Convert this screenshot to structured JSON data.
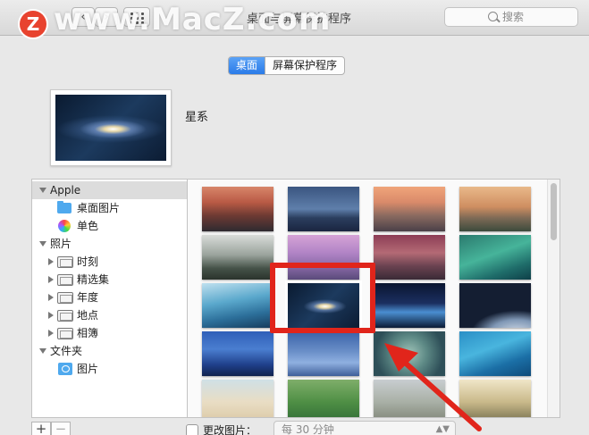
{
  "window": {
    "title": "桌面与屏幕保护程序",
    "back_glyph": "‹",
    "forward_glyph": "›",
    "grid_icon": "grid-icon"
  },
  "watermark": {
    "badge": "Z",
    "text": "www.MacZ.com"
  },
  "search": {
    "placeholder": "搜索",
    "icon": "search-icon"
  },
  "tabs": [
    {
      "label": "桌面",
      "active": true
    },
    {
      "label": "屏幕保护程序",
      "active": false
    }
  ],
  "current": {
    "name": "星系"
  },
  "sidebar": {
    "groups": [
      {
        "label": "Apple",
        "expanded": true,
        "items": [
          {
            "label": "桌面图片",
            "icon": "folder-icon"
          },
          {
            "label": "单色",
            "icon": "color-wheel-icon"
          }
        ]
      },
      {
        "label": "照片",
        "expanded": true,
        "items": [
          {
            "label": "时刻",
            "icon": "album-icon"
          },
          {
            "label": "精选集",
            "icon": "album-icon"
          },
          {
            "label": "年度",
            "icon": "album-icon"
          },
          {
            "label": "地点",
            "icon": "album-icon"
          },
          {
            "label": "相簿",
            "icon": "album-icon"
          }
        ]
      },
      {
        "label": "文件夹",
        "expanded": true,
        "items": [
          {
            "label": "图片",
            "icon": "pictures-folder-icon"
          }
        ]
      }
    ]
  },
  "wallpapers": {
    "selected_index": 9,
    "items": [
      "el-capitan-sunset",
      "night-ridge",
      "half-dome-sunset",
      "el-capitan-day",
      "foggy-forest",
      "pink-dome",
      "lake-rocks",
      "green-wave",
      "blue-wave",
      "galaxy",
      "earth-horizon",
      "earth-orbit",
      "blue-storm",
      "sky-stars",
      "green-cloud",
      "blue-water",
      "beach",
      "green-fields",
      "foggy-field",
      "sunbeam-forest"
    ]
  },
  "bottom": {
    "add_label": "+",
    "remove_label": "−",
    "change_picture_label": "更改图片：",
    "change_picture_checked": false,
    "interval_value": "每 30 分钟"
  },
  "colors": {
    "accent": "#2a7be8",
    "annotation_red": "#e1251b"
  }
}
